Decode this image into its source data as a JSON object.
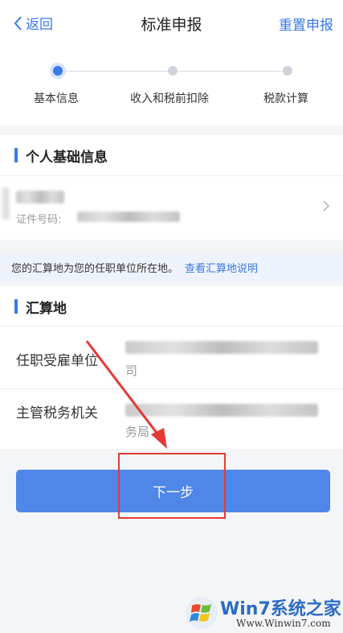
{
  "nav": {
    "back_label": "返回",
    "title": "标准申报",
    "reset_label": "重置申报"
  },
  "steps": [
    {
      "label": "基本信息",
      "active": true
    },
    {
      "label": "收入和税前扣除",
      "active": false
    },
    {
      "label": "税款计算",
      "active": false
    }
  ],
  "personal": {
    "section_title": "个人基础信息",
    "cert_label": "证件号码:"
  },
  "notice": {
    "text": "您的汇算地为您的任职单位所在地。",
    "link": "查看汇算地说明"
  },
  "settlement": {
    "section_title": "汇算地",
    "employer_label": "任职受雇单位",
    "employer_tail": "司",
    "tax_office_label": "主管税务机关",
    "tax_office_tail": "务局"
  },
  "next_button": "下一步",
  "watermark": {
    "title": "Win7系统之家",
    "url": "Www.Winwin7.com"
  },
  "colors": {
    "accent": "#3a78e6",
    "button": "#4f86e8",
    "annotation": "#e53935"
  }
}
